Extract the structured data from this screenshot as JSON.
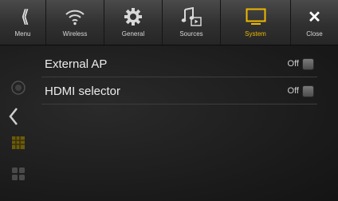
{
  "topbar": {
    "items": [
      {
        "label": "Menu",
        "icon": "double-chevron-left-icon"
      },
      {
        "label": "Wireless",
        "icon": "wifi-icon"
      },
      {
        "label": "General",
        "icon": "gear-icon"
      },
      {
        "label": "Sources",
        "icon": "music-note-icon"
      },
      {
        "label": "System",
        "icon": "monitor-icon",
        "active": true
      },
      {
        "label": "Close",
        "icon": "close-icon"
      }
    ]
  },
  "settings": {
    "rows": [
      {
        "title": "External AP",
        "value": "Off"
      },
      {
        "title": "HDMI selector",
        "value": "Off"
      }
    ]
  },
  "colors": {
    "accent": "#f0b800",
    "background": "#1e1e1e",
    "text": "#ececec"
  }
}
